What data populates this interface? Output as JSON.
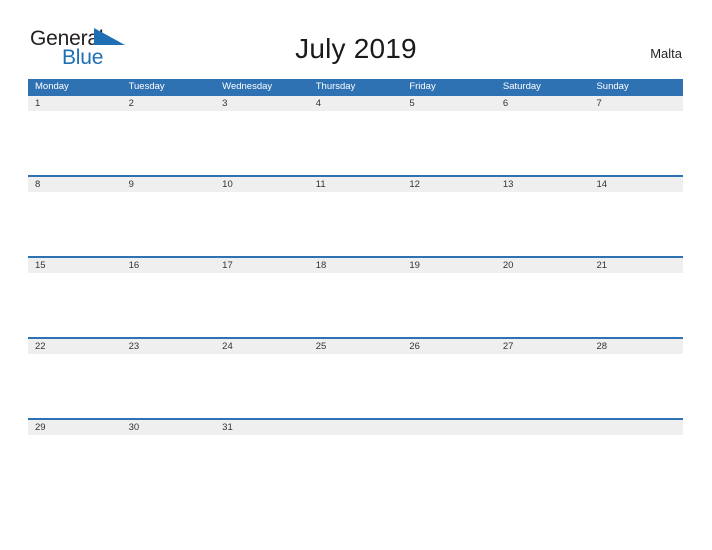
{
  "brand": {
    "line1": "General",
    "line2": "Blue",
    "flag_icon": "blue-triangle-flag-icon",
    "accent_color": "#1f6fb5",
    "text_color": "#231f20"
  },
  "header": {
    "title": "July 2019",
    "country": "Malta"
  },
  "colors": {
    "header_blue": "#2e72b4",
    "row_band_gray": "#efefef",
    "page_background": "#ffffff",
    "day_number_text": "#333333"
  },
  "calendar": {
    "month": "July",
    "year": "2019",
    "weekday_headers": [
      "Monday",
      "Tuesday",
      "Wednesday",
      "Thursday",
      "Friday",
      "Saturday",
      "Sunday"
    ],
    "weeks": [
      {
        "days": [
          "1",
          "2",
          "3",
          "4",
          "5",
          "6",
          "7"
        ]
      },
      {
        "days": [
          "8",
          "9",
          "10",
          "11",
          "12",
          "13",
          "14"
        ]
      },
      {
        "days": [
          "15",
          "16",
          "17",
          "18",
          "19",
          "20",
          "21"
        ]
      },
      {
        "days": [
          "22",
          "23",
          "24",
          "25",
          "26",
          "27",
          "28"
        ]
      },
      {
        "days": [
          "29",
          "30",
          "31",
          "",
          "",
          "",
          ""
        ]
      }
    ]
  }
}
